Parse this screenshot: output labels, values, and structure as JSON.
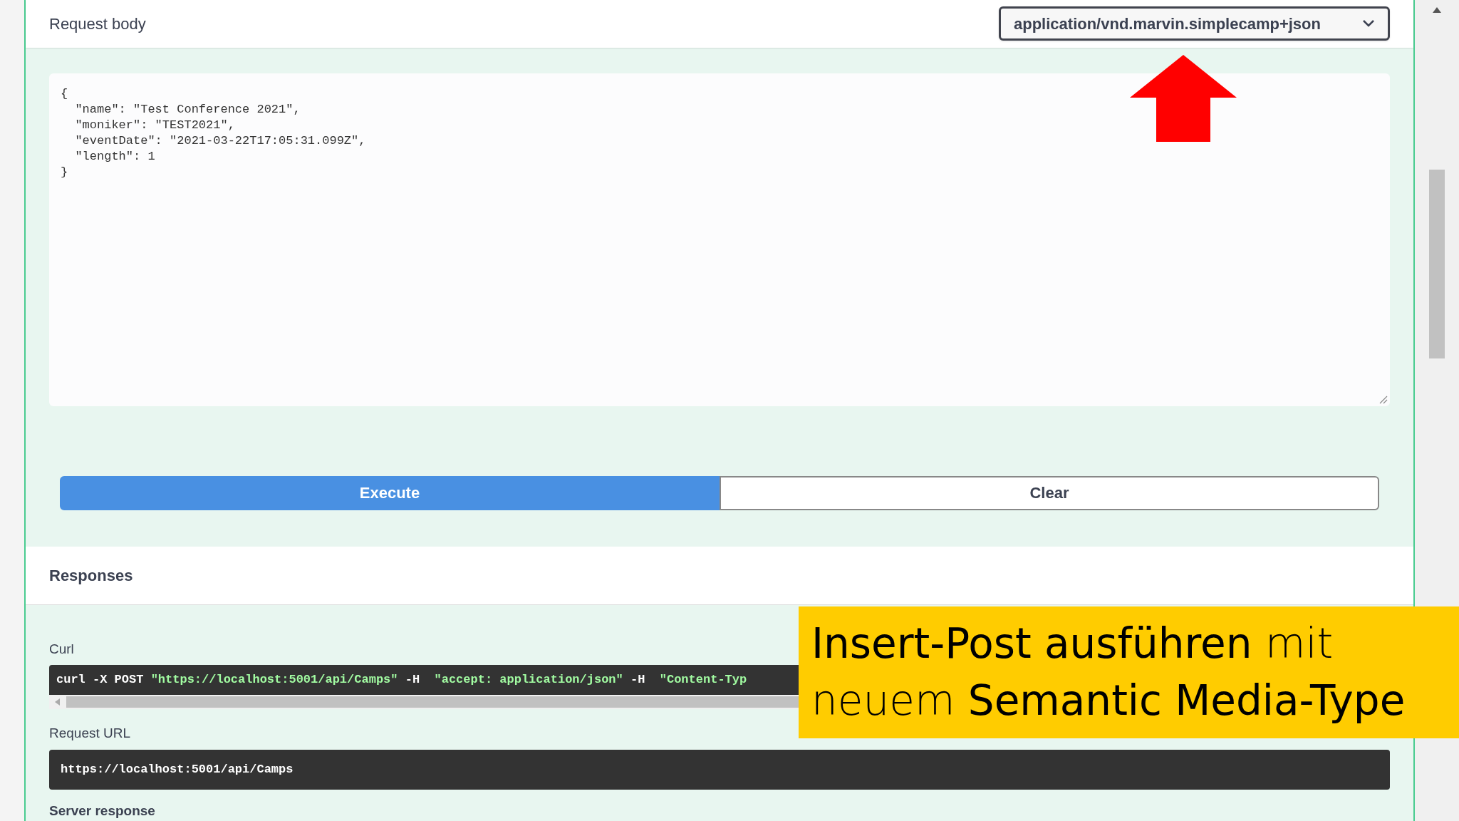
{
  "request_body": {
    "title": "Request body",
    "media_type": "application/vnd.marvin.simplecamp+json",
    "code_lines": [
      "{",
      "  \"name\": \"Test Conference 2021\",",
      "  \"moniker\": \"TEST2021\",",
      "  \"eventDate\": \"2021-03-22T17:05:31.099Z\",",
      "  \"length\": 1",
      "}"
    ]
  },
  "buttons": [
    {
      "label": "Execute",
      "kind": "primary"
    },
    {
      "label": "Clear",
      "kind": "secondary"
    }
  ],
  "responses": {
    "title": "Responses",
    "curl_label": "Curl",
    "curl_parts": [
      {
        "text": "curl -X POST ",
        "kind": "plain"
      },
      {
        "text": "\"https://localhost:5001/api/Camps\"",
        "kind": "string"
      },
      {
        "text": " -H  ",
        "kind": "plain"
      },
      {
        "text": "\"accept: application/json\"",
        "kind": "string"
      },
      {
        "text": " -H  ",
        "kind": "plain"
      },
      {
        "text": "\"Content-Typ",
        "kind": "string"
      }
    ],
    "request_url_label": "Request URL",
    "request_url": "https://localhost:5001/api/Camps",
    "server_response_label": "Server response"
  },
  "caption": {
    "lines": [
      "**Insert-Post ausführen** mit",
      "neuem **Semantic Media-Type**"
    ]
  }
}
